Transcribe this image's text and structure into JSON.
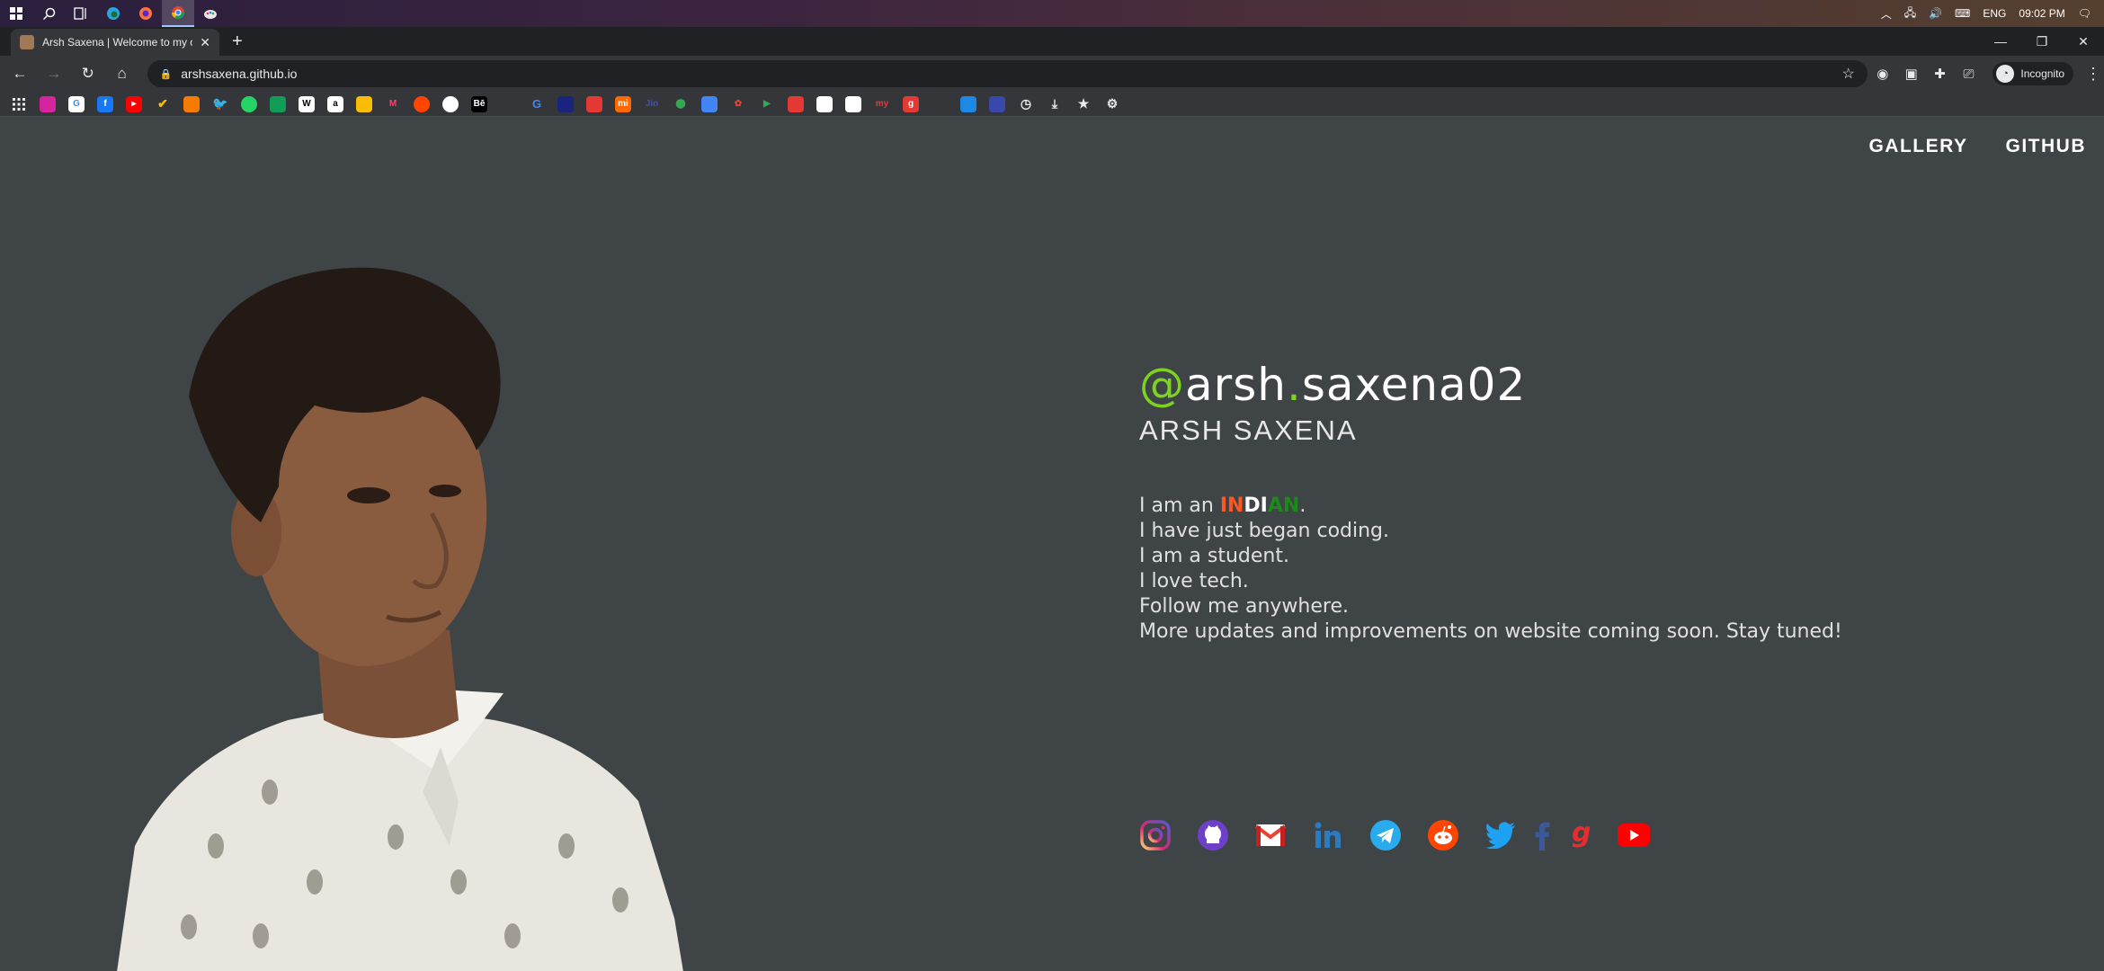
{
  "taskbar": {
    "language": "ENG",
    "time": "09:02 PM"
  },
  "tab": {
    "title": "Arsh Saxena | Welcome to my offi",
    "close": "✕",
    "new_tab": "+"
  },
  "window_controls": {
    "minimize": "—",
    "restore": "❐",
    "close": "✕"
  },
  "address_bar": {
    "url": "arshsaxena.github.io",
    "profile_label": "Incognito"
  },
  "site": {
    "nav": {
      "gallery": "GALLERY",
      "github": "GITHUB"
    },
    "handle": {
      "at": "@",
      "part1": "arsh",
      "dot": ".",
      "part2": "saxena02"
    },
    "name": "ARSH SAXENA",
    "bio": {
      "line1_prefix": "I am an ",
      "indian_1": "IN",
      "indian_2": "DI",
      "indian_3": "AN",
      "line1_suffix": ".",
      "line2": "I have just began coding.",
      "line3": "I am a student.",
      "line4": "I love tech.",
      "line5": "Follow me anywhere.",
      "line6": "More updates and improvements on website coming soon. Stay tuned!"
    },
    "socials": [
      "instagram",
      "github",
      "gmail",
      "linkedin",
      "telegram",
      "reddit",
      "twitter",
      "facebook",
      "gaana",
      "youtube"
    ]
  },
  "colors": {
    "page_bg": "#3f4447",
    "accent_green": "#7ed321",
    "saffron": "#ff5722",
    "india_green": "#1b8a1b"
  }
}
